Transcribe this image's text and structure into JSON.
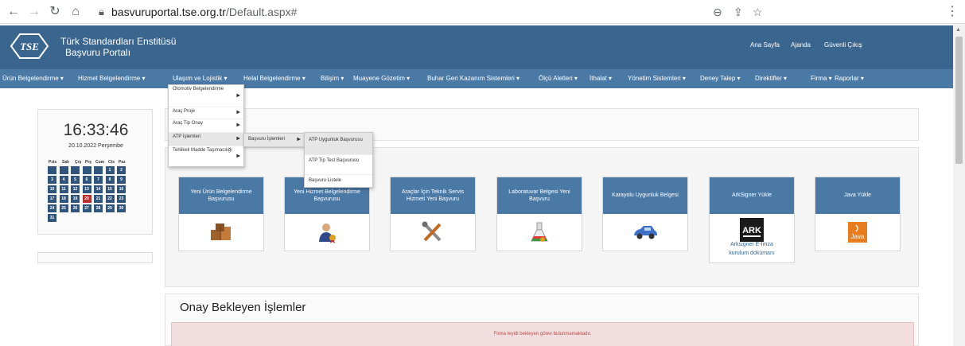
{
  "browser": {
    "url_host": "basvuruportal.tse.org.tr",
    "url_path": "/Default.aspx#"
  },
  "header": {
    "logo_text": "TSE",
    "brand_line1": "Türk Standardları Enstitüsü",
    "brand_line2": "Başvuru Portalı",
    "links": [
      "Ana Sayfa",
      "Ajanda",
      "Güvenli Çıkış"
    ]
  },
  "nav": {
    "items": [
      "Ürün Belgelendirme ▾",
      "Hizmet Belgelendirme ▾",
      "Ulaşım ve Lojistik ▾",
      "Helal Belgelendirme ▾",
      "Bilişim ▾",
      "Muayene Gözetim ▾",
      "Buhar Geri Kazanım Sistemleri ▾",
      "Ölçü Aletleri ▾",
      "İthalat ▾",
      "Yönetim Sistemleri ▾",
      "Deney Talep ▾",
      "Direktifler ▾",
      "Firma ▾",
      "Raporlar ▾"
    ]
  },
  "dropdown1": {
    "items": [
      {
        "label": "Otomotiv Belgelendirme"
      },
      {
        "label": "Araç Proje"
      },
      {
        "label": "Araç Tip Onay"
      },
      {
        "label": "ATP İşlemleri"
      },
      {
        "label": "Tehlikeli Madde Taşımacılığı"
      }
    ]
  },
  "dropdown2": {
    "items": [
      {
        "label": "Başvuru İşlemleri"
      }
    ]
  },
  "dropdown3": {
    "items": [
      {
        "label": "ATP Uygunluk Başvurusu"
      },
      {
        "label": "ATP Tip Test Başvurusu"
      },
      {
        "label": "Başvuru Listele"
      }
    ]
  },
  "clock": {
    "time": "16:33:46",
    "date": "20.10.2022 Perşembe",
    "weekdays": [
      "Pzts",
      "Salı",
      "Çrş",
      "Prş",
      "Cum",
      "Cts",
      "Paz"
    ],
    "days": [
      "",
      "",
      "",
      "",
      "",
      "1",
      "2",
      "3",
      "4",
      "5",
      "6",
      "7",
      "8",
      "9",
      "10",
      "11",
      "12",
      "13",
      "14",
      "15",
      "16",
      "17",
      "18",
      "19",
      "20",
      "21",
      "22",
      "23",
      "24",
      "25",
      "26",
      "27",
      "28",
      "29",
      "30",
      "31"
    ],
    "today": "20"
  },
  "cards": [
    {
      "title": "Yeni Ürün Belgelendirme Başvurusu",
      "icon": "boxes-icon"
    },
    {
      "title": "Yeni Hizmet Belgelendirme Başvurusu",
      "icon": "person-certificate-icon"
    },
    {
      "title": "Araçlar İçin Teknik Servis Hizmeti Yeni Başvuru",
      "icon": "tools-icon"
    },
    {
      "title": "Laboratuvar Belgesi Yeni Başvuru",
      "icon": "flask-icon"
    },
    {
      "title": "Karayolu Uygunluk Belgesi",
      "icon": "car-icon"
    },
    {
      "title": "ArkSigner Yükle",
      "icon": "arksigner-logo",
      "extra1": "Arksigner E-İmza",
      "extra2": "kurulum dokümanı"
    },
    {
      "title": "Java Yükle",
      "icon": "java-logo"
    }
  ],
  "onay": {
    "title": "Onay Bekleyen İşlemler",
    "message": "Firma teyidi bekleyen görev bulunmamaktadır."
  },
  "colors": {
    "header": "#39658f",
    "nav": "#4a79a6",
    "calendar_day": "#30557c",
    "calendar_today": "#b7302e",
    "alert_bg": "#f2dede"
  }
}
